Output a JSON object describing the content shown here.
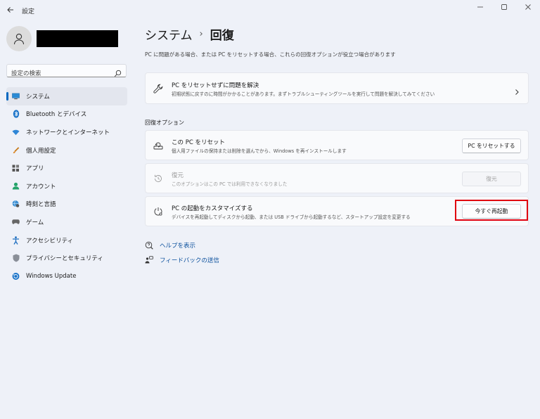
{
  "window": {
    "title": "設定",
    "back_icon": "back-arrow-icon",
    "controls": [
      "minimize-icon",
      "maximize-icon",
      "close-icon"
    ]
  },
  "search": {
    "placeholder": "設定の検索"
  },
  "sidebar": {
    "items": [
      {
        "label": "システム",
        "icon": "display-icon",
        "active": true
      },
      {
        "label": "Bluetooth とデバイス",
        "icon": "bluetooth-icon"
      },
      {
        "label": "ネットワークとインターネット",
        "icon": "wifi-icon"
      },
      {
        "label": "個人用設定",
        "icon": "brush-icon"
      },
      {
        "label": "アプリ",
        "icon": "apps-icon"
      },
      {
        "label": "アカウント",
        "icon": "account-icon"
      },
      {
        "label": "時刻と言語",
        "icon": "globe-clock-icon"
      },
      {
        "label": "ゲーム",
        "icon": "gamepad-icon"
      },
      {
        "label": "アクセシビリティ",
        "icon": "accessibility-icon"
      },
      {
        "label": "プライバシーとセキュリティ",
        "icon": "shield-icon"
      },
      {
        "label": "Windows Update",
        "icon": "windows-update-icon"
      }
    ]
  },
  "breadcrumb": {
    "parent": "システム",
    "separator": "›",
    "current": "回復"
  },
  "page_description": "PC に問題がある場合、または PC をリセットする場合、これらの回復オプションが役立つ場合があります",
  "troubleshoot_card": {
    "title": "PC をリセットせずに問題を解決",
    "description": "初期状態に戻すのに時間がかかることがあります。まずトラブルシューティングツールを実行して問題を解決してみてください"
  },
  "recovery_options": {
    "section_label": "回復オプション",
    "reset": {
      "title": "この PC をリセット",
      "description": "個人用ファイルの保持または削除を選んでから、Windows を再インストールします",
      "button": "PC をリセットする"
    },
    "restore": {
      "title": "復元",
      "description": "このオプションはこの PC では利用できなくなりました",
      "button": "復元",
      "disabled": true
    },
    "advanced_startup": {
      "title": "PC の起動をカスタマイズする",
      "description": "デバイスを再起動してディスクから起動、または USB ドライブから起動するなど、スタートアップ設定を変更する",
      "button": "今すぐ再起動",
      "highlighted": true
    }
  },
  "links": {
    "help": "ヘルプを表示",
    "feedback": "フィードバックの送信"
  },
  "colors": {
    "accent": "#0067c0",
    "highlight_border": "#e0000f",
    "link": "#0a4f9c"
  }
}
